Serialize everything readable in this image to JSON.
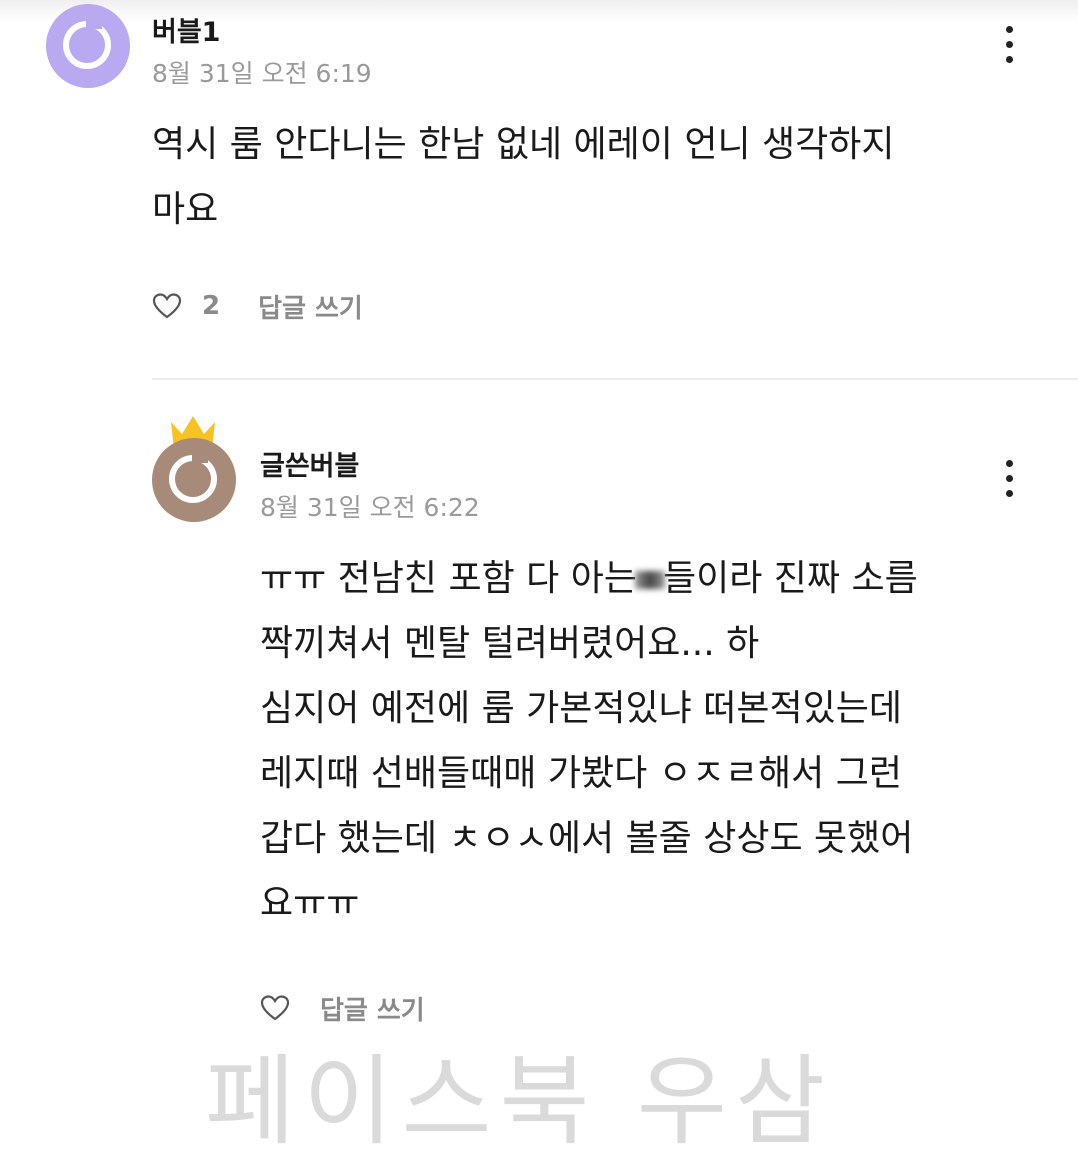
{
  "comments": [
    {
      "author": "버블1",
      "time": "8월 31일 오전 6:19",
      "lines": [
        "역시 룸 안다니는 한남 없네 에레이 언니 생각하지",
        "마요"
      ],
      "like_count": "2",
      "reply_label": "답글 쓰기",
      "avatar_color": "#b9a9f0",
      "avatar_icon": "profile-ring-icon"
    },
    {
      "author": "글쓴버블",
      "time": "8월 31일 오전 6:22",
      "lines": [
        "ㅠㅠ 전남친 포함 다 아는",
        "짝끼쳐서 멘탈 털려버렸어요... 하",
        "심지어 예전에 룸 가본적있냐 떠본적있는데",
        "레지때 선배들때매 가봤다 ㅇㅈㄹ해서 그런",
        "갑다 했는데 ㅊㅇㅅ에서 볼줄 상상도 못했어",
        "요ㅠㅠ"
      ],
      "line1_tail": "들이라 진짜 소름",
      "reply_label": "답글 쓰기",
      "avatar_color": "#a88a78",
      "badge_icon": "crown-icon",
      "badge_color": "#f6c323",
      "avatar_icon": "profile-ring-icon"
    }
  ],
  "watermark": "페이스북 우삼",
  "icons": [
    "more-vertical-icon",
    "heart-icon"
  ]
}
